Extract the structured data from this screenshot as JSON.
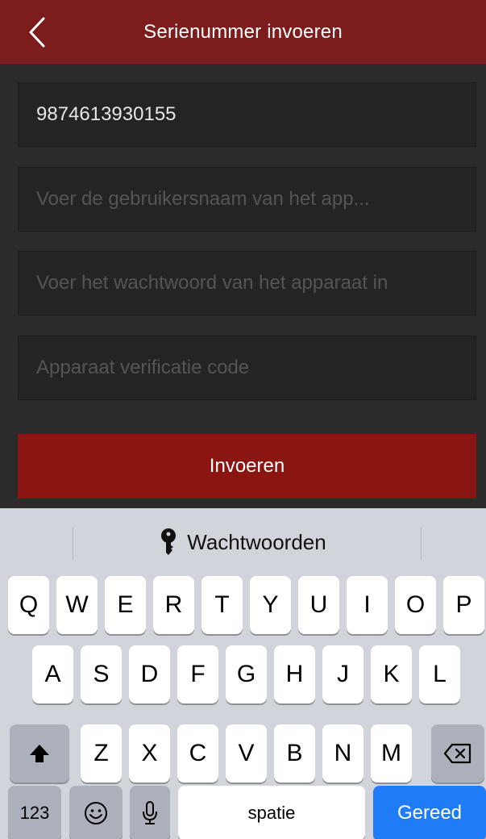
{
  "header": {
    "title": "Serienummer invoeren",
    "back_icon": "chevron-left-icon"
  },
  "form": {
    "serial_value": "9874613930155",
    "username_placeholder": "Voer de gebruikersnaam van het app...",
    "password_placeholder": "Voer het wachtwoord van het apparaat in",
    "verification_placeholder": "Apparaat verificatie code",
    "submit_label": "Invoeren"
  },
  "keyboard": {
    "suggestion": "Wachtwoorden",
    "row1": [
      "Q",
      "W",
      "E",
      "R",
      "T",
      "Y",
      "U",
      "I",
      "O",
      "P"
    ],
    "row2": [
      "A",
      "S",
      "D",
      "F",
      "G",
      "H",
      "J",
      "K",
      "L"
    ],
    "row3": [
      "Z",
      "X",
      "C",
      "V",
      "B",
      "N",
      "M"
    ],
    "numbers_label": "123",
    "space_label": "spatie",
    "done_label": "Gereed"
  },
  "colors": {
    "header_bg": "#7d1c1c",
    "button_bg": "#8b1510",
    "done_key": "#1f7cf6"
  }
}
